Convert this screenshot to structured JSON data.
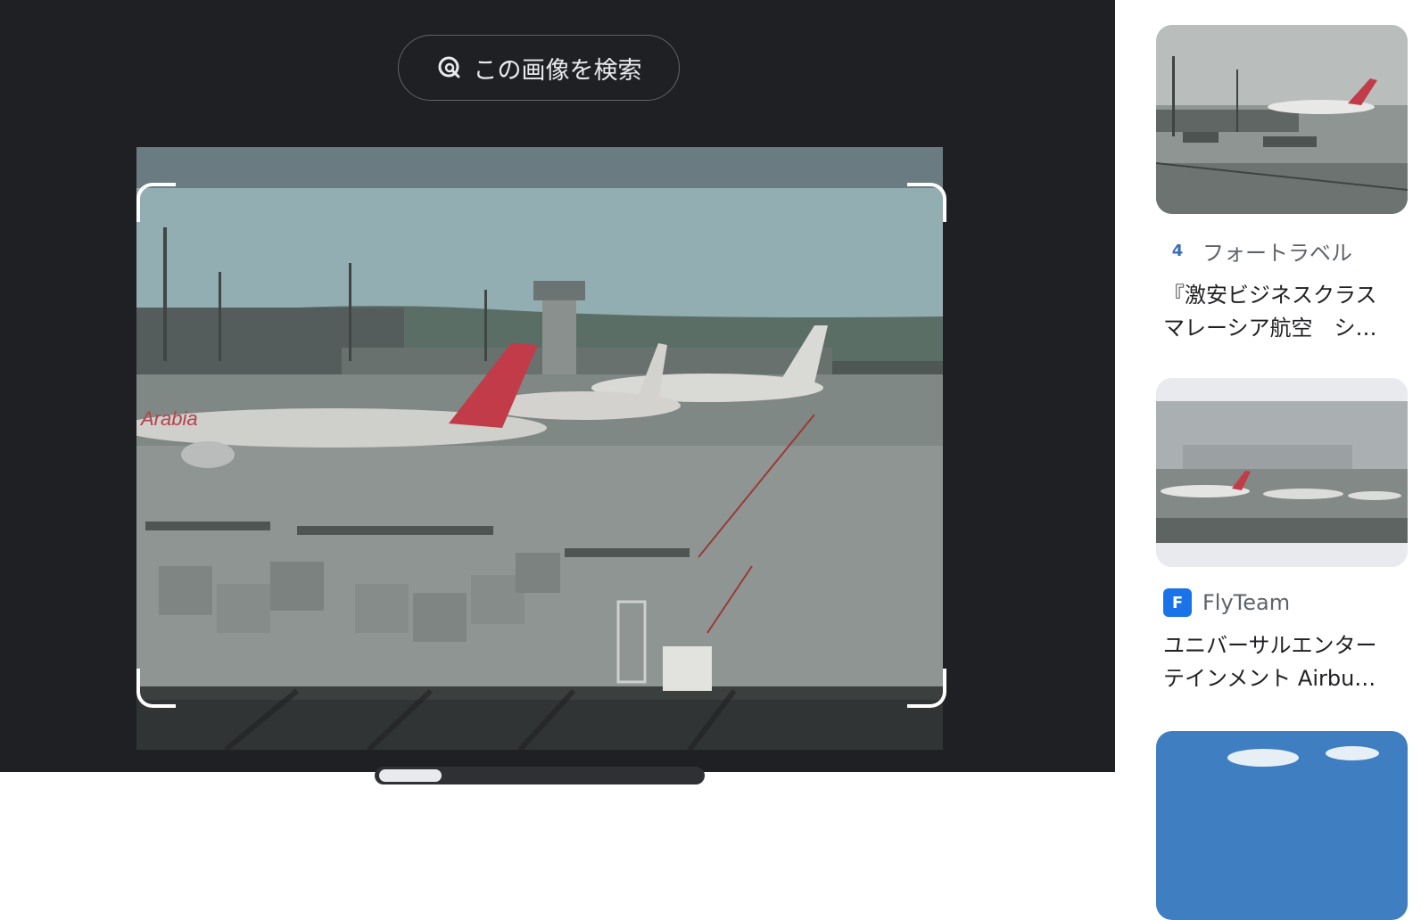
{
  "search_button": {
    "label": "この画像を検索",
    "icon": "lens-search-icon"
  },
  "main_image": {
    "alt_subject": "",
    "visible_text": {
      "tail_text": "Arabia",
      "tail_small": "Arabia"
    }
  },
  "results": [
    {
      "source": "フォートラベル",
      "favicon": "4",
      "title_line1": "『激安ビジネスクラス",
      "title_line2": "マレーシア航空　シ…"
    },
    {
      "source": "FlyTeam",
      "favicon": "F",
      "title_line1": "ユニバーサルエンター",
      "title_line2": "テインメント Airbu…"
    }
  ],
  "colors": {
    "left_bg": "#1f2024",
    "right_bg": "#ffffff",
    "accent": "#1a73e8"
  }
}
